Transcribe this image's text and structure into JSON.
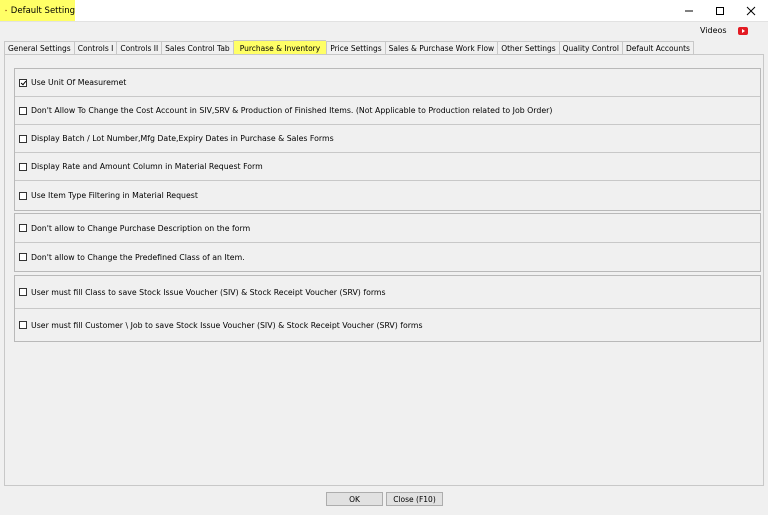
{
  "window": {
    "title": "Default Setting",
    "highlight_color": "#ffff66"
  },
  "header": {
    "videos_label": "Videos",
    "video_icon_color": "#e31b23"
  },
  "tabs": [
    {
      "label": "General Settings",
      "active": false
    },
    {
      "label": "Controls I",
      "active": false
    },
    {
      "label": "Controls II",
      "active": false
    },
    {
      "label": "Sales Control Tab",
      "active": false
    },
    {
      "label": "Purchase & Inventory",
      "active": true
    },
    {
      "label": "Price Settings",
      "active": false
    },
    {
      "label": "Sales & Purchase Work Flow",
      "active": false
    },
    {
      "label": "Other Settings",
      "active": false
    },
    {
      "label": "Quality Control",
      "active": false
    },
    {
      "label": "Default Accounts",
      "active": false
    }
  ],
  "groups": [
    {
      "options": [
        {
          "label": "Use Unit Of Measuremet",
          "checked": true
        },
        {
          "label": "Don't Allow To Change the Cost Account in SIV,SRV & Production of Finished Items. (Not Applicable to Production related to Job Order)",
          "checked": false
        },
        {
          "label": "Display Batch / Lot Number,Mfg Date,Expiry Dates in Purchase & Sales Forms",
          "checked": false
        },
        {
          "label": "Display Rate and Amount Column in Material Request Form",
          "checked": false
        },
        {
          "label": "Use Item Type Filtering in Material Request",
          "checked": false
        }
      ]
    },
    {
      "options": [
        {
          "label": "Don't allow to Change Purchase Description  on the form",
          "checked": false
        },
        {
          "label": "Don't allow to Change the Predefined Class of an Item.",
          "checked": false
        }
      ]
    },
    {
      "options": [
        {
          "label": "User must fill Class to save Stock Issue Voucher (SIV) & Stock Receipt Voucher (SRV) forms",
          "checked": false
        },
        {
          "label": "User must fill Customer \\ Job to save Stock Issue Voucher (SIV) & Stock Receipt Voucher (SRV) forms",
          "checked": false
        }
      ]
    }
  ],
  "footer": {
    "ok_label": "OK",
    "close_label": "Close (F10)"
  }
}
